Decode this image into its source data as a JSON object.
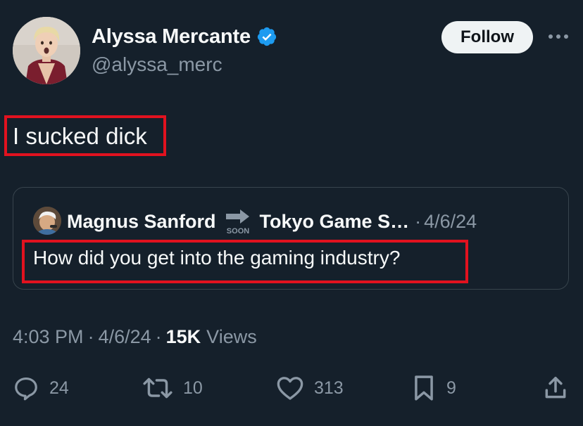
{
  "author": {
    "display_name": "Alyssa Mercante",
    "handle": "@alyssa_merc",
    "verified": true
  },
  "follow_label": "Follow",
  "tweet": {
    "text": "I sucked dick"
  },
  "quoted_tweet": {
    "display_name": "Magnus Sanford",
    "badge_text": "SOON",
    "secondary_name": "Tokyo Game S…",
    "separator": "·",
    "date": "4/6/24",
    "text": "How did you get into the gaming industry?"
  },
  "meta": {
    "time": "4:03 PM",
    "sep1": "·",
    "date": "4/6/24",
    "sep2": "·",
    "views_count": "15K",
    "views_label": "Views"
  },
  "actions": {
    "replies": "24",
    "reposts": "10",
    "likes": "313",
    "bookmarks": "9"
  },
  "icons": {
    "verified": "verified-badge-icon",
    "more": "more-dots-icon",
    "reply": "reply-icon",
    "repost": "repost-icon",
    "like": "heart-icon",
    "bookmark": "bookmark-icon",
    "share": "share-icon"
  },
  "colors": {
    "background": "#15202b",
    "text_primary": "#f7f9f9",
    "text_secondary": "#8b98a5",
    "verified_blue": "#1d9bf0",
    "highlight_red": "#e1121f",
    "border": "#38444d"
  }
}
